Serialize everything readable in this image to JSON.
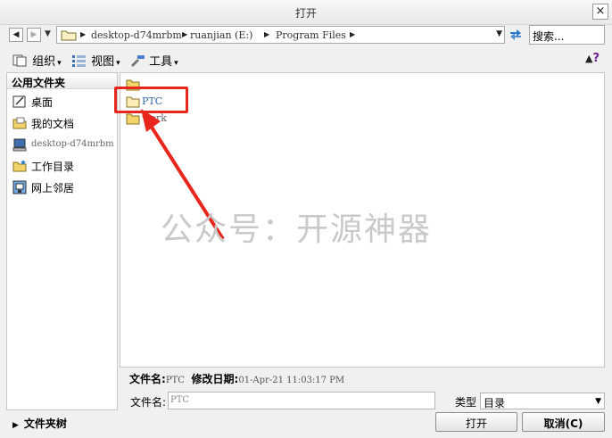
{
  "window": {
    "title": "打开",
    "close_glyph": "×"
  },
  "nav": {
    "back_glyph": "◀",
    "forward_glyph": "▶",
    "history_glyph": "▼",
    "breadcrumbs": [
      "desktop-d74mrbm",
      "ruanjian (E:)",
      "Program Files"
    ],
    "address_dropdown_glyph": "▼",
    "search_placeholder": "搜索..."
  },
  "toolbar": {
    "organize_label": "组织",
    "view_label": "视图",
    "tools_label": "工具",
    "chevron": "▾",
    "help_glyph": "?"
  },
  "sidebar": {
    "header": "公用文件夹",
    "items": [
      {
        "label": "桌面",
        "icon": "desktop-icon"
      },
      {
        "label": "我的文档",
        "icon": "documents-icon"
      },
      {
        "label": "desktop-d74mrbm",
        "icon": "computer-icon"
      },
      {
        "label": "工作目录",
        "icon": "working-directory-icon"
      },
      {
        "label": "网上邻居",
        "icon": "network-icon"
      }
    ]
  },
  "files": [
    {
      "name": "",
      "icon": "folder-icon"
    },
    {
      "name": "PTC",
      "icon": "folder-icon"
    },
    {
      "name": "work",
      "icon": "folder-icon"
    }
  ],
  "watermark": "公众号：开源神器",
  "info": {
    "name_label": "文件名:",
    "name_value": "PTC",
    "date_label": "修改日期:",
    "date_value": "01-Apr-21 11:03:17 PM"
  },
  "filename_row": {
    "label": "文件名:",
    "value": "PTC",
    "type_label": "类型",
    "type_value": "目录",
    "type_chevron": "▼"
  },
  "bottom": {
    "folder_tree_label": "文件夹树",
    "folder_tree_glyph": "▶",
    "open_label": "打开",
    "cancel_label": "取消(C)"
  },
  "colors": {
    "highlight": "#e8261c",
    "watermark": "#c9c9c9",
    "folder": "#f3d46a"
  }
}
